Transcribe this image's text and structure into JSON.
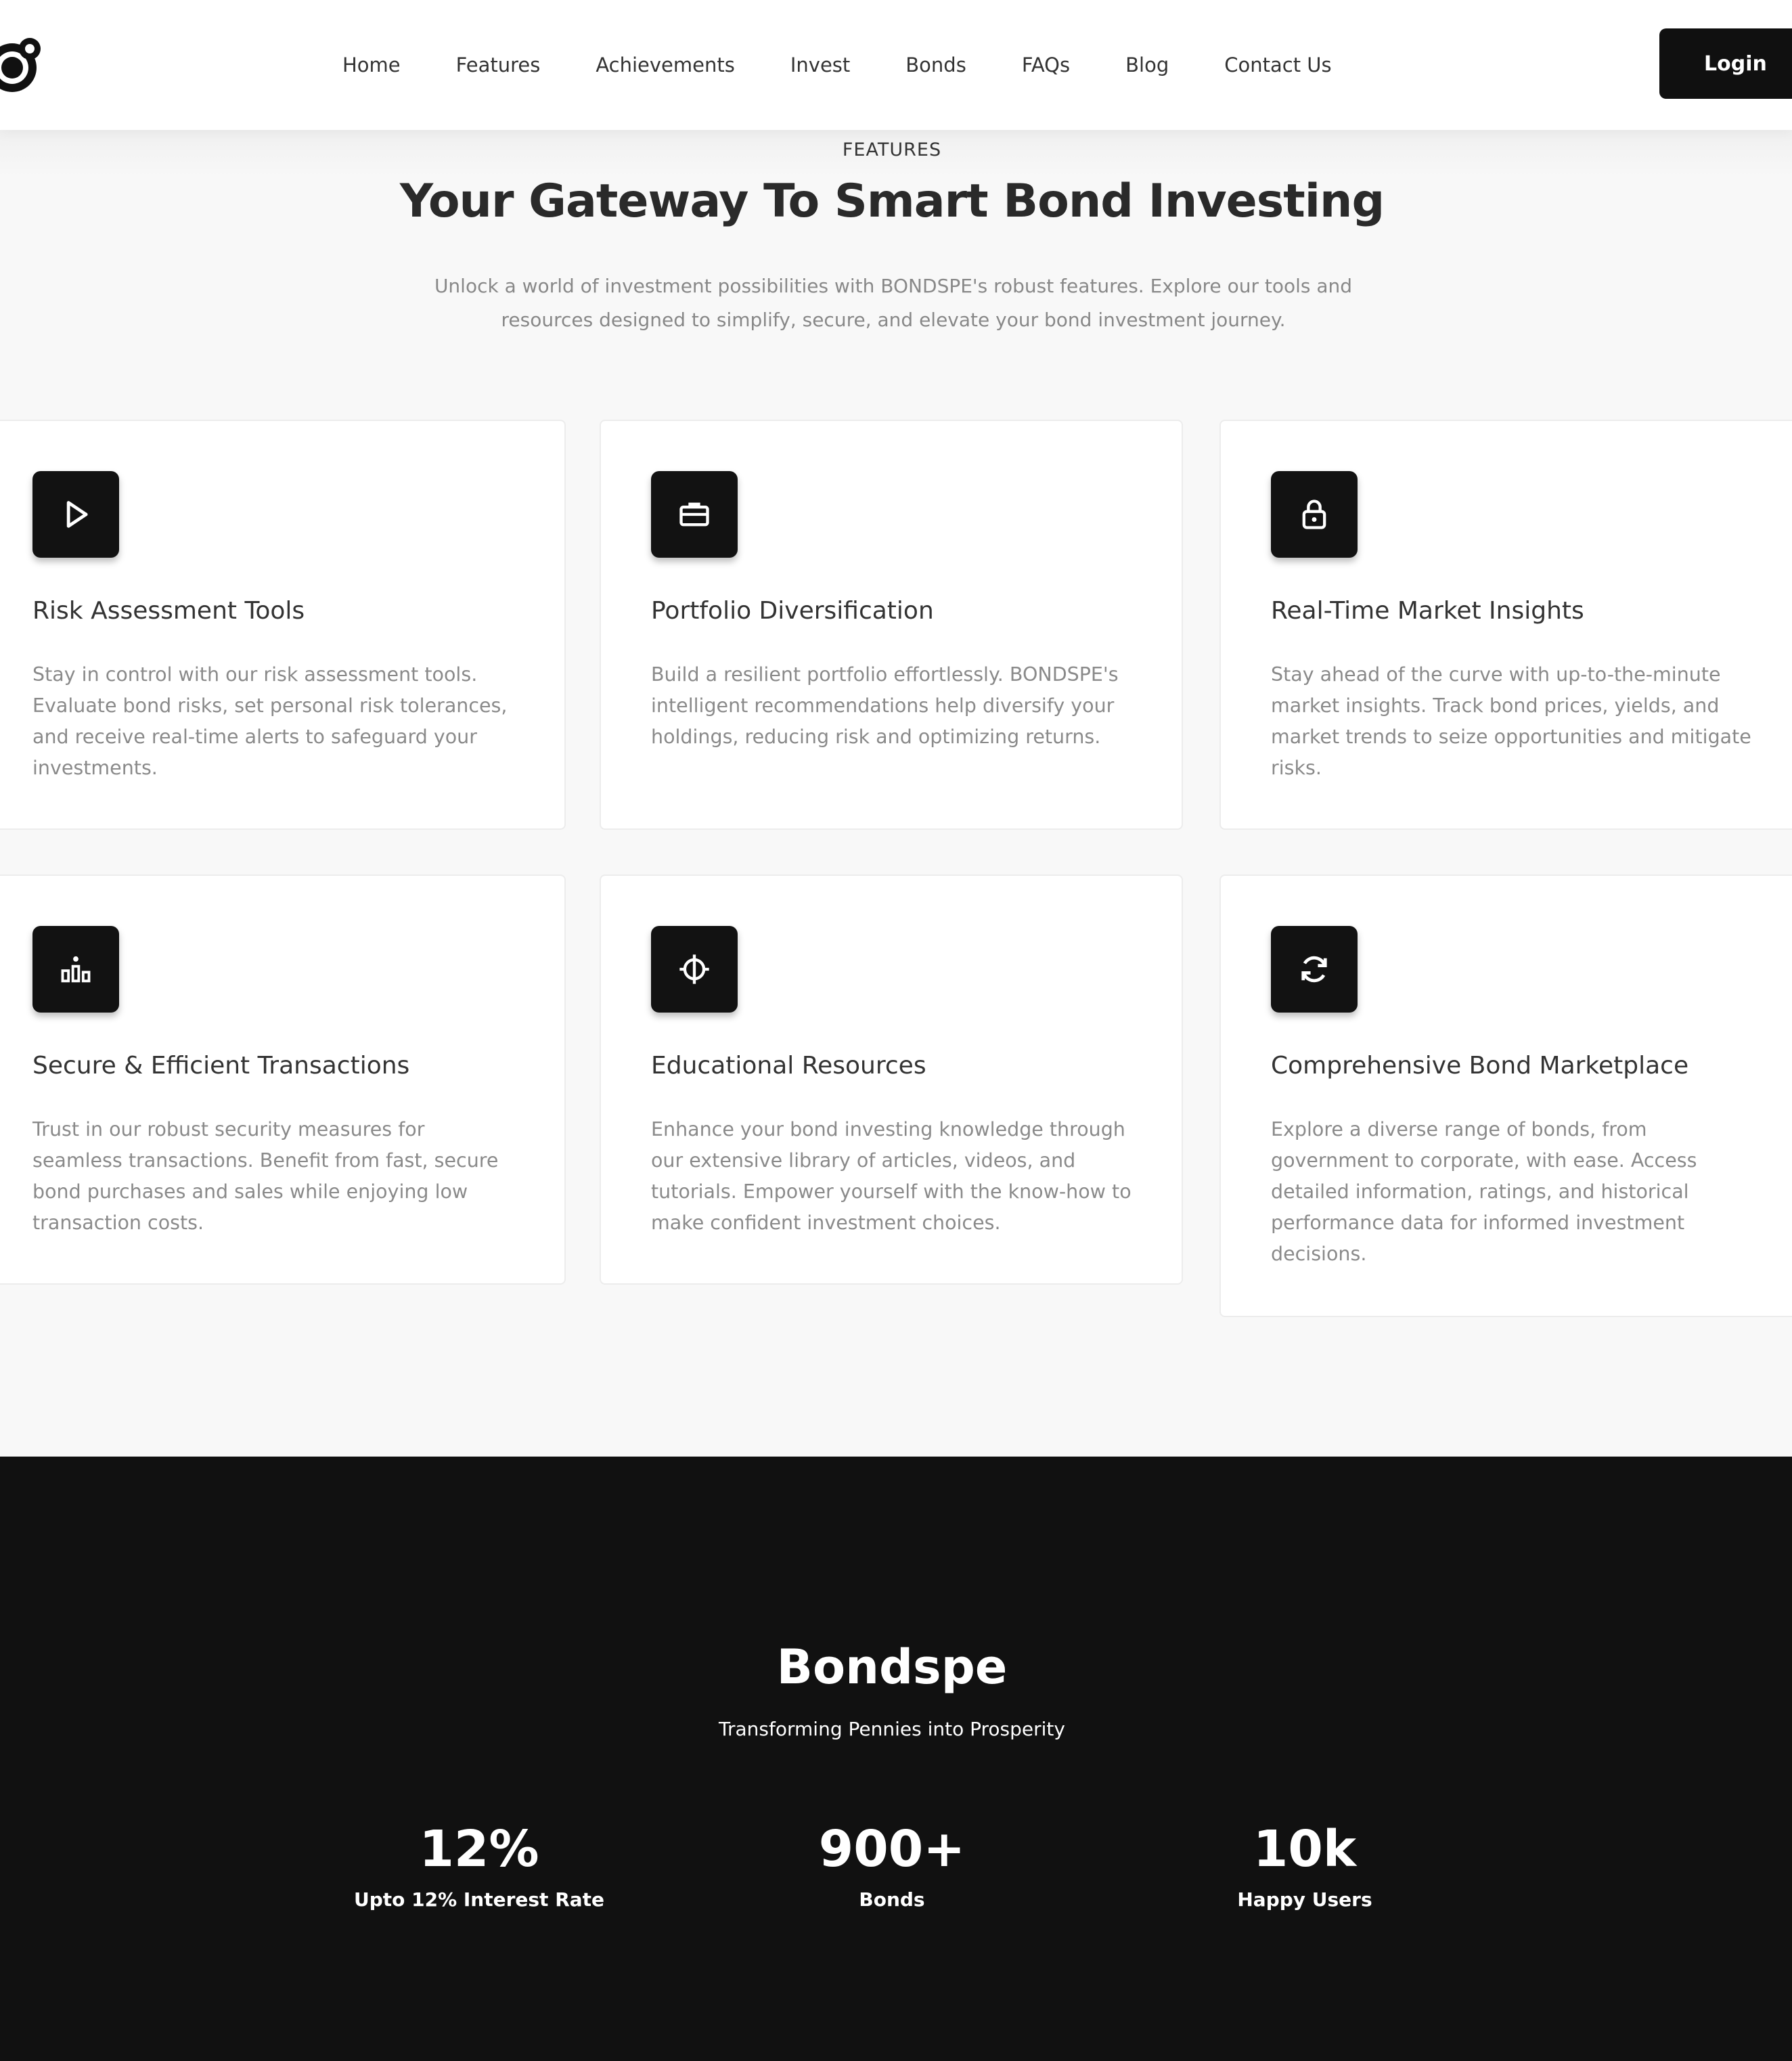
{
  "nav": {
    "links": [
      "Home",
      "Features",
      "Achievements",
      "Invest",
      "Bonds",
      "FAQs",
      "Blog",
      "Contact Us"
    ],
    "login_label": "Login"
  },
  "features": {
    "eyebrow": "FEATURES",
    "heading": "Your Gateway To Smart Bond Investing",
    "subtext": "Unlock a world of investment possibilities with BONDSPE's robust features. Explore our tools and resources designed to simplify, secure, and elevate your bond investment journey.",
    "cards": [
      {
        "icon": "play-icon",
        "title": "Risk Assessment Tools",
        "desc": "Stay in control with our risk assessment tools. Evaluate bond risks, set personal risk tolerances, and receive real-time alerts to safeguard your investments."
      },
      {
        "icon": "briefcase-icon",
        "title": "Portfolio Diversification",
        "desc": "Build a resilient portfolio effortlessly. BONDSPE's intelligent recommendations help diversify your holdings, reducing risk and optimizing returns."
      },
      {
        "icon": "lock-icon",
        "title": "Real-Time Market Insights",
        "desc": "Stay ahead of the curve with up-to-the-minute market insights. Track bond prices, yields, and market trends to seize opportunities and mitigate risks."
      },
      {
        "icon": "podium-icon",
        "title": "Secure & Efficient Transactions",
        "desc": "Trust in our robust security measures for seamless transactions. Benefit from fast, secure bond purchases and sales while enjoying low transaction costs."
      },
      {
        "icon": "target-icon",
        "title": "Educational Resources",
        "desc": "Enhance your bond investing knowledge through our extensive library of articles, videos, and tutorials. Empower yourself with the know-how to make confident investment choices."
      },
      {
        "icon": "refresh-icon",
        "title": "Comprehensive Bond Marketplace",
        "desc": "Explore a diverse range of bonds, from government to corporate, with ease. Access detailed information, ratings, and historical performance data for informed investment decisions."
      }
    ]
  },
  "stats": {
    "brand": "Bondspe",
    "tagline": "Transforming Pennies into Prosperity",
    "items": [
      {
        "value": "12%",
        "label": "Upto 12% Interest Rate"
      },
      {
        "value": "900+",
        "label": "Bonds"
      },
      {
        "value": "10k",
        "label": "Happy Users"
      }
    ]
  }
}
